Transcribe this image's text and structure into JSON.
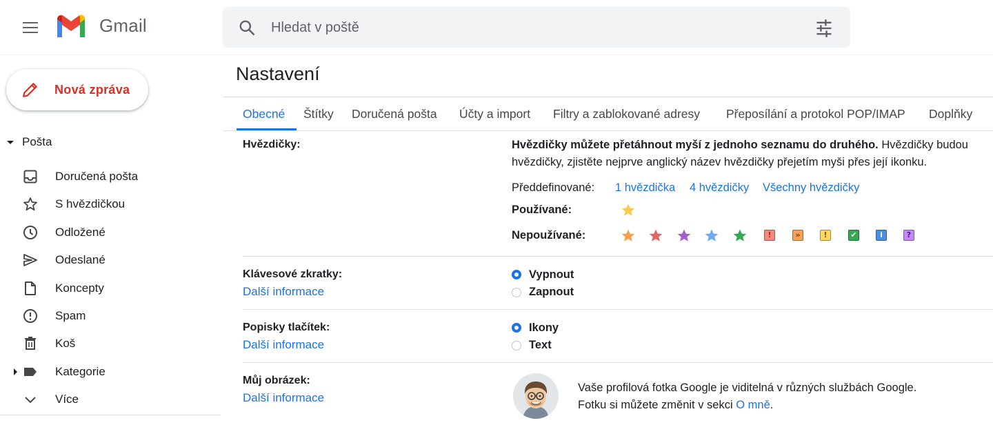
{
  "app": {
    "name": "Gmail"
  },
  "search": {
    "placeholder": "Hledat v poště"
  },
  "sidebar": {
    "compose_label": "Nová zpráva",
    "section_label": "Pošta",
    "items": [
      {
        "label": "Doručená pošta",
        "icon": "inbox-icon"
      },
      {
        "label": "S hvězdičkou",
        "icon": "star-icon"
      },
      {
        "label": "Odložené",
        "icon": "clock-icon"
      },
      {
        "label": "Odeslané",
        "icon": "send-icon"
      },
      {
        "label": "Koncepty",
        "icon": "draft-icon"
      },
      {
        "label": "Spam",
        "icon": "spam-icon"
      },
      {
        "label": "Koš",
        "icon": "trash-icon"
      },
      {
        "label": "Kategorie",
        "icon": "label-icon"
      },
      {
        "label": "Více",
        "icon": "chevron-down-icon"
      }
    ]
  },
  "main": {
    "title": "Nastavení",
    "tabs": [
      {
        "label": "Obecné",
        "active": true
      },
      {
        "label": "Štítky"
      },
      {
        "label": "Doručená pošta"
      },
      {
        "label": "Účty a import"
      },
      {
        "label": "Filtry a zablokované adresy"
      },
      {
        "label": "Přeposílání a protokol POP/IMAP"
      },
      {
        "label": "Doplňky"
      }
    ],
    "more_info_label": "Další informace",
    "stars": {
      "label": "Hvězdičky:",
      "desc_bold": "Hvězdičky můžete přetáhnout myší z jednoho seznamu do druhého.",
      "desc_rest": " Hvězdičky budou",
      "desc_line2": "hvězdičky, zjistěte nejprve anglický název hvězdičky přejetím myši přes její ikonku.",
      "predefined_label": "Předdefinované:",
      "presets": [
        "1 hvězdička",
        "4 hvězdičky",
        "Všechny hvězdičky"
      ],
      "in_use_label": "Používané:",
      "not_in_use_label": "Nepoužívané:",
      "in_use": [
        {
          "icon": "yellow-star-icon",
          "color": "#f7cb4d"
        }
      ],
      "not_in_use": [
        {
          "icon": "orange-star-icon",
          "color": "#f6a04d"
        },
        {
          "icon": "red-star-icon",
          "color": "#e06666"
        },
        {
          "icon": "purple-star-icon",
          "color": "#a060c8"
        },
        {
          "icon": "blue-star-icon",
          "color": "#6fa8f0"
        },
        {
          "icon": "green-star-icon",
          "color": "#34a853"
        },
        {
          "icon": "red-bang-icon",
          "glyph": "!",
          "color": "#f28b82",
          "fg": "#c5221f"
        },
        {
          "icon": "orange-guillemet-icon",
          "glyph": "»",
          "color": "#f5a35b",
          "fg": "#7a3d00"
        },
        {
          "icon": "yellow-bang-icon",
          "glyph": "!",
          "color": "#fdd663",
          "fg": "#7a5d00"
        },
        {
          "icon": "green-check-icon",
          "glyph": "✔",
          "color": "#34a853",
          "fg": "#ffffff"
        },
        {
          "icon": "blue-info-icon",
          "glyph": "i",
          "color": "#4a90e2",
          "fg": "#ffffff"
        },
        {
          "icon": "purple-question-icon",
          "glyph": "?",
          "color": "#c58af9",
          "fg": "#4a148c"
        }
      ]
    },
    "shortcuts": {
      "label": "Klávesové zkratky:",
      "options": [
        {
          "label": "Vypnout",
          "selected": true
        },
        {
          "label": "Zapnout",
          "selected": false
        }
      ]
    },
    "button_labels": {
      "label": "Popisky tlačítek:",
      "options": [
        {
          "label": "Ikony",
          "selected": true
        },
        {
          "label": "Text",
          "selected": false
        }
      ]
    },
    "picture": {
      "label": "Můj obrázek:",
      "line1": "Vaše profilová fotka Google je viditelná v různých službách Google.",
      "line2_prefix": "Fotku si můžete změnit v sekci ",
      "line2_link": "O mně",
      "line2_suffix": "."
    }
  }
}
